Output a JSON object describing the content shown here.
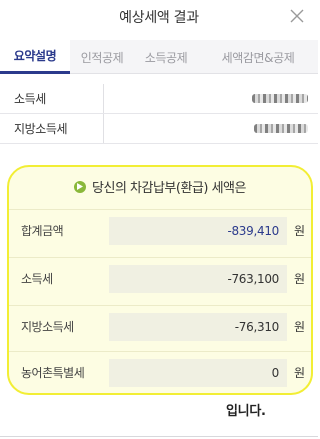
{
  "header": {
    "title": "예상세액 결과"
  },
  "tabs": [
    {
      "label": "요약설명"
    },
    {
      "label": "인적공제"
    },
    {
      "label": "소득공제"
    },
    {
      "label": "세액감면&공제"
    }
  ],
  "summary": {
    "rows": [
      {
        "label": "소득세"
      },
      {
        "label": "지방소득세"
      }
    ]
  },
  "result": {
    "title": "당신의 차감납부(환급) 세액은",
    "unit": "원",
    "rows": [
      {
        "label": "합계금액",
        "value": "-839,410"
      },
      {
        "label": "소득세",
        "value": "-763,100"
      },
      {
        "label": "지방소득세",
        "value": "-76,310"
      },
      {
        "label": "농어촌특별세",
        "value": "0"
      }
    ],
    "suffix": "입니다."
  },
  "colors": {
    "accent": "#2b3a8c",
    "highlight": "#f2ee34",
    "icon": "#8ab83a"
  }
}
